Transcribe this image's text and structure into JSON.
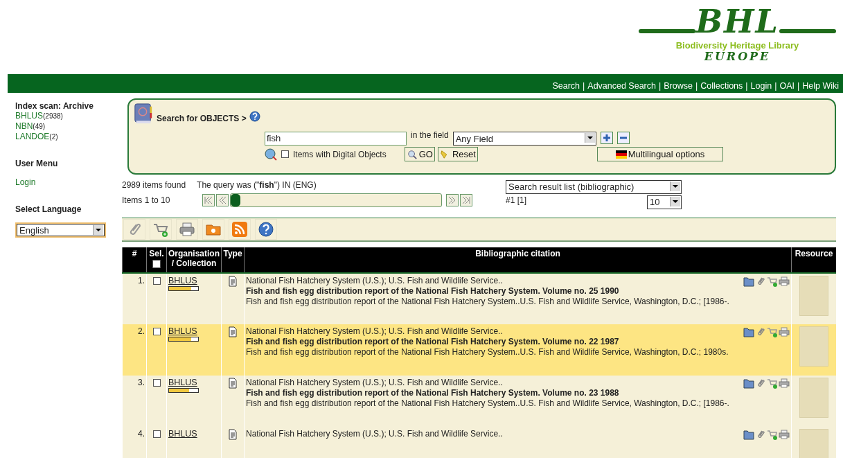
{
  "logo": {
    "mark": "BHL",
    "subtitle": "Biodiversity Heritage Library",
    "region": "EUROPE"
  },
  "nav": {
    "separator": "|",
    "links": [
      "Search",
      "Advanced Search",
      "Browse",
      "Collections",
      "Login",
      "OAI",
      "Help Wiki"
    ]
  },
  "sidebar": {
    "index_title": "Index scan: Archive",
    "collections": [
      {
        "name": "BHLUS",
        "count": "(2938)"
      },
      {
        "name": "NBN",
        "count": "(49)"
      },
      {
        "name": "LANDOE",
        "count": "(2)"
      }
    ],
    "user_menu_title": "User Menu",
    "user_menu": [
      "Login"
    ],
    "language_title": "Select Language",
    "language": "English"
  },
  "search": {
    "title": "Search for OBJECTS >",
    "query": "fish",
    "field_label": "in the field",
    "field": "Any Field",
    "digital_only": {
      "label": "Items with Digital Objects",
      "checked": false
    },
    "go": "GO",
    "reset": "Reset",
    "multilingual": "Multilingual options"
  },
  "results": {
    "found": "2989 items found",
    "query_text": "The query was (\"**fish**\") IN (ENG)",
    "range": "Items 1 to 10",
    "pager": {
      "level": 0
    },
    "view": "Search result list (bibliographic)",
    "page_marker": "#1 [1]",
    "per_page": "10"
  },
  "table": {
    "columns": [
      "#",
      "Sel.",
      "Organisation / Collection",
      "Type",
      "Bibliographic citation",
      "Resource"
    ],
    "select_all": false,
    "rows": [
      {
        "number": "1.",
        "checked": false,
        "highlighted": false,
        "collection": "BHLUS",
        "level": 0.75,
        "author": "National Fish Hatchery System (U.S.); U.S. Fish and Wildlife Service..",
        "title": "Fish and fish egg distribution report of the National Fish Hatchery System. Volume no. 25 1990",
        "imprint": "Fish and fish egg distribution report of the National Fish Hatchery System..U.S. Fish and Wildlife Service, Washington, D.C.; [1986-."
      },
      {
        "number": "2.",
        "checked": false,
        "highlighted": true,
        "collection": "BHLUS",
        "level": 0.75,
        "author": "National Fish Hatchery System (U.S.); U.S. Fish and Wildlife Service..",
        "title": "Fish and fish egg distribution report of the National Fish Hatchery System. Volume no. 22 1987",
        "imprint": "Fish and fish egg distribution report of the National Fish Hatchery System..U.S. Fish and Wildlife Service, Washington, D.C.; 1980s."
      },
      {
        "number": "3.",
        "checked": false,
        "highlighted": false,
        "collection": "BHLUS",
        "level": 0.7,
        "author": "National Fish Hatchery System (U.S.); U.S. Fish and Wildlife Service..",
        "title": "Fish and fish egg distribution report of the National Fish Hatchery System. Volume no. 23 1988",
        "imprint": "Fish and fish egg distribution report of the National Fish Hatchery System..U.S. Fish and Wildlife Service, Washington, D.C.; [1986-."
      },
      {
        "number": "4.",
        "checked": false,
        "highlighted": false,
        "collection": "BHLUS",
        "author": "National Fish Hatchery System (U.S.); U.S. Fish and Wildlife Service.."
      }
    ]
  }
}
